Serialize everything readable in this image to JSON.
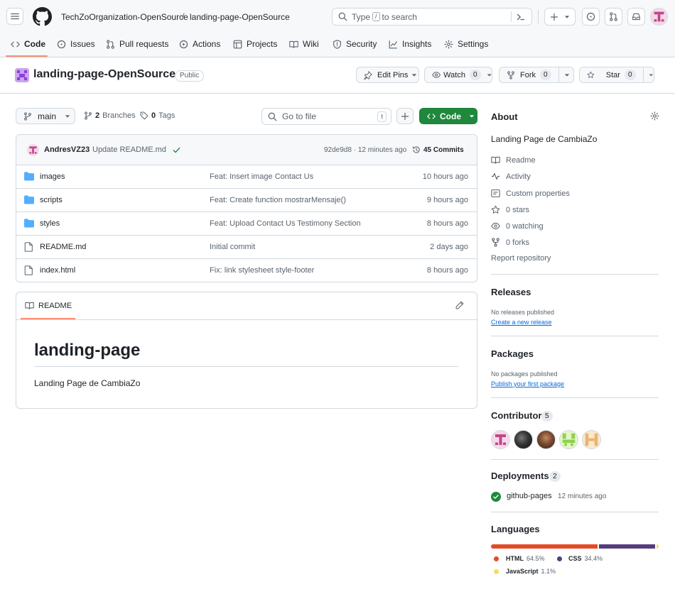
{
  "header": {
    "org": "TechZoOrganization-OpenSource",
    "slash": "/",
    "repo": "landing-page-OpenSource",
    "search_prefix": "Type",
    "search_key": "/",
    "search_suffix": "to search"
  },
  "tabs": [
    {
      "label": "Code",
      "icon": "code-icon"
    },
    {
      "label": "Issues",
      "icon": "issue-icon"
    },
    {
      "label": "Pull requests",
      "icon": "pull-request-icon"
    },
    {
      "label": "Actions",
      "icon": "play-icon"
    },
    {
      "label": "Projects",
      "icon": "table-icon"
    },
    {
      "label": "Wiki",
      "icon": "book-icon"
    },
    {
      "label": "Security",
      "icon": "shield-icon"
    },
    {
      "label": "Insights",
      "icon": "graph-icon"
    },
    {
      "label": "Settings",
      "icon": "gear-icon"
    }
  ],
  "repo": {
    "name": "landing-page-OpenSource",
    "visibility": "Public",
    "edit_pins": "Edit Pins",
    "watch": "Watch",
    "watch_count": "0",
    "fork": "Fork",
    "fork_count": "0",
    "star": "Star",
    "star_count": "0"
  },
  "toolbar": {
    "branch": "main",
    "branches_count": "2",
    "branches_label": "Branches",
    "tags_count": "0",
    "tags_label": "Tags",
    "goto_placeholder": "Go to file",
    "goto_key": "t",
    "code_label": "Code"
  },
  "commit": {
    "author": "AndresVZ23",
    "message": "Update README.md",
    "hash_time": "92de9d8 · 12 minutes ago",
    "commits": "45 Commits"
  },
  "files": [
    {
      "name": "images",
      "type": "folder",
      "message": "Feat: Insert image Contact Us",
      "time": "10 hours ago"
    },
    {
      "name": "scripts",
      "type": "folder",
      "message": "Feat: Create function mostrarMensaje()",
      "time": "9 hours ago"
    },
    {
      "name": "styles",
      "type": "folder",
      "message": "Feat: Upload Contact Us Testimony Section",
      "time": "8 hours ago"
    },
    {
      "name": "README.md",
      "type": "file",
      "message": "Initial commit",
      "time": "2 days ago"
    },
    {
      "name": "index.html",
      "type": "file",
      "message": "Fix: link stylesheet style-footer",
      "time": "8 hours ago"
    }
  ],
  "readme": {
    "tab": "README",
    "heading": "landing-page",
    "body": "Landing Page de CambiaZo"
  },
  "about": {
    "title": "About",
    "description": "Landing Page de CambiaZo",
    "items": [
      "Readme",
      "Activity",
      "Custom properties",
      "0 stars",
      "0 watching",
      "0 forks"
    ],
    "report": "Report repository"
  },
  "releases": {
    "title": "Releases",
    "none": "No releases published",
    "create": "Create a new release"
  },
  "packages": {
    "title": "Packages",
    "none": "No packages published",
    "publish": "Publish your first package"
  },
  "contributors": {
    "title": "Contributors",
    "count": "5"
  },
  "deployments": {
    "title": "Deployments",
    "count": "2",
    "env": "github-pages",
    "time": "12 minutes ago"
  },
  "languages": {
    "title": "Languages",
    "items": [
      {
        "name": "HTML",
        "percent": "64.5%",
        "value": 64.5,
        "color": "#e34c26"
      },
      {
        "name": "CSS",
        "percent": "34.4%",
        "value": 34.4,
        "color": "#563d7c"
      },
      {
        "name": "JavaScript",
        "percent": "1.1%",
        "value": 1.1,
        "color": "#f1e05a"
      }
    ]
  },
  "colors": {
    "accent": "#fd8c73",
    "green": "#1f883d",
    "folder": "#54aeff"
  }
}
